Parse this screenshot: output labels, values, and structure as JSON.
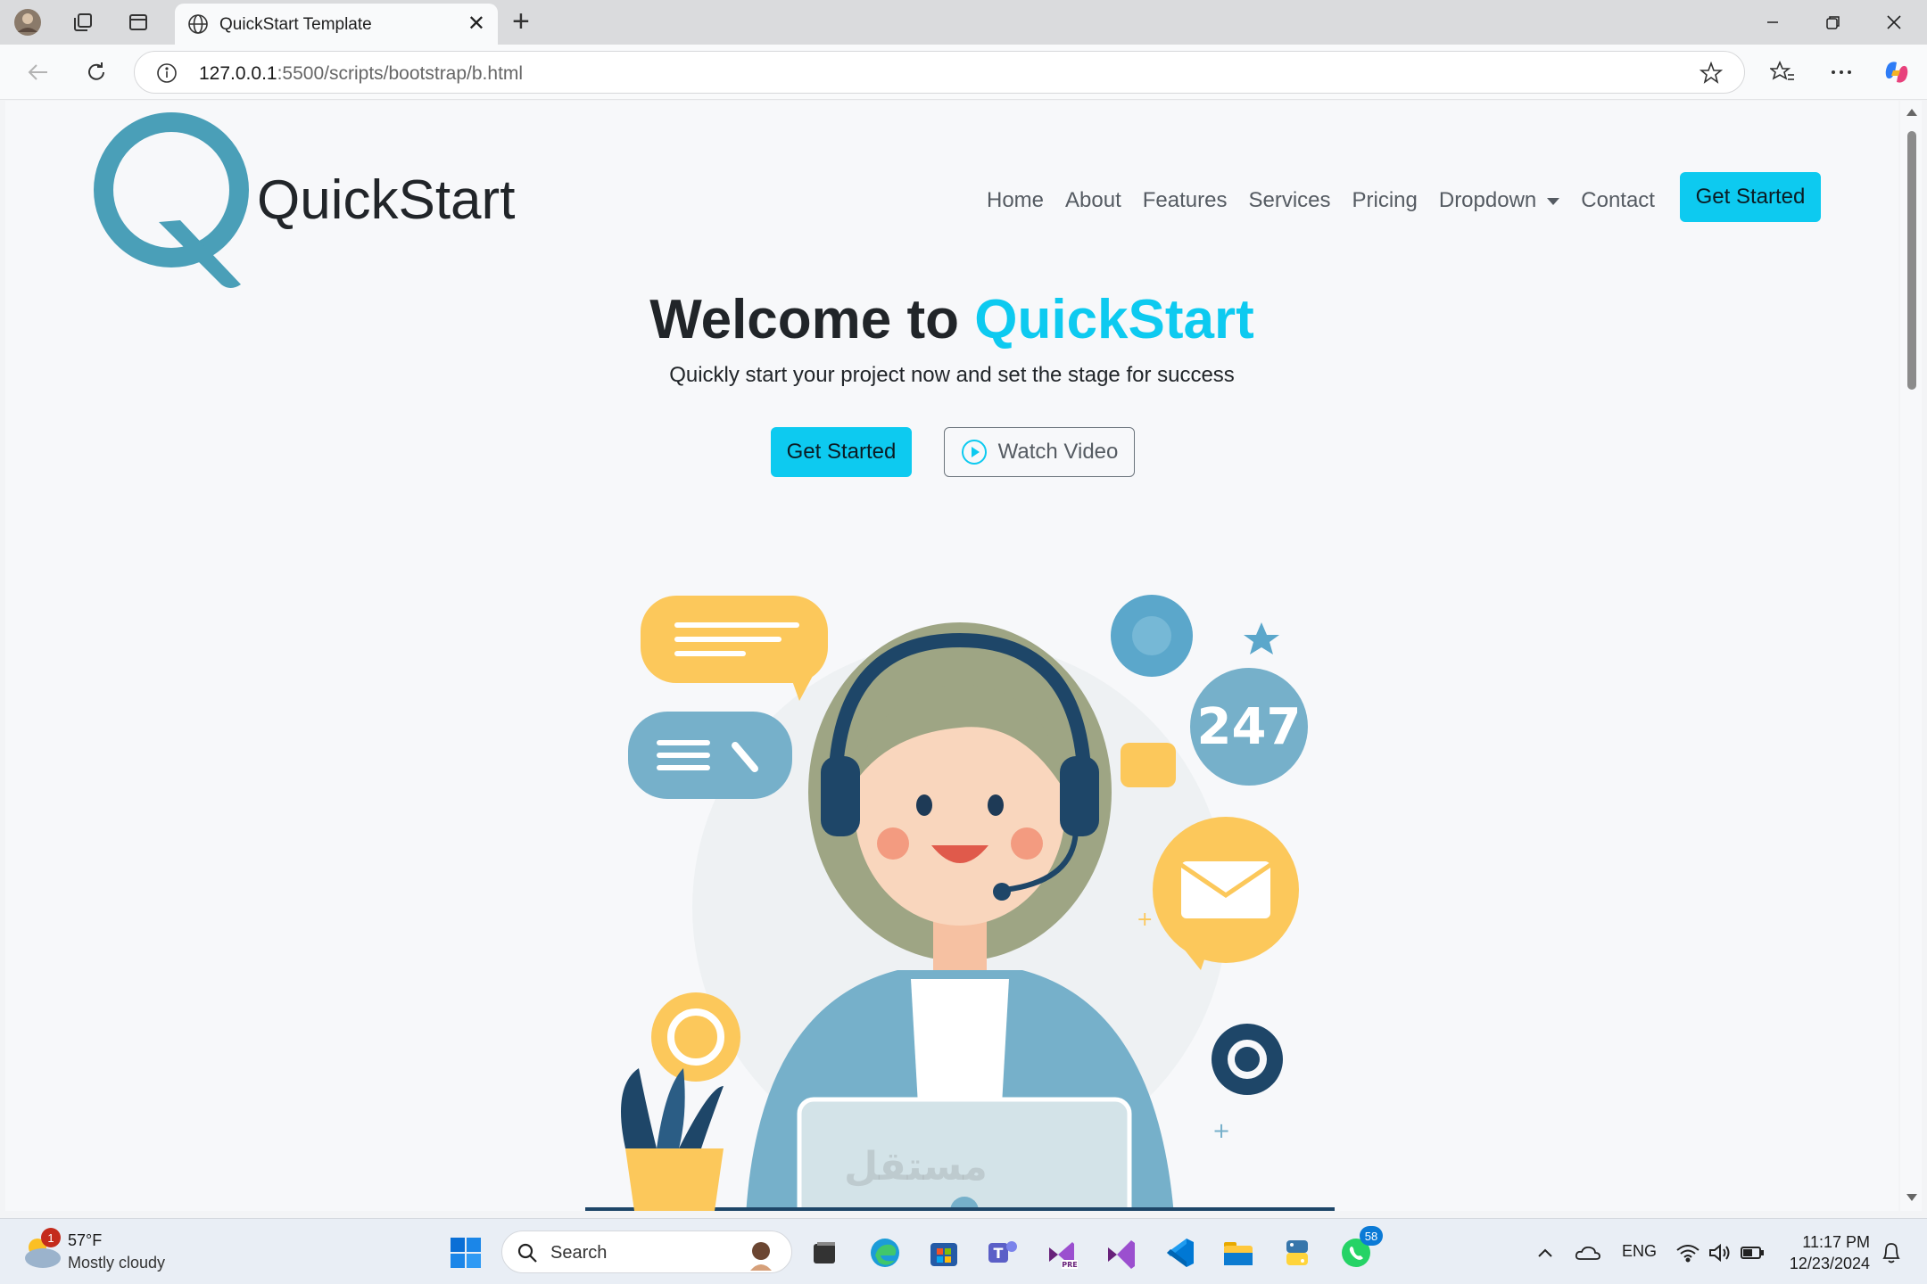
{
  "browser": {
    "tab_title": "QuickStart Template",
    "url_host": "127.0.0.1",
    "url_rest": ":5500/scripts/bootstrap/b.html"
  },
  "site": {
    "brand": "QuickStart",
    "nav": {
      "home": "Home",
      "about": "About",
      "features": "Features",
      "services": "Services",
      "pricing": "Pricing",
      "dropdown": "Dropdown",
      "contact": "Contact",
      "cta": "Get Started"
    },
    "hero": {
      "title_prefix": "Welcome to ",
      "title_accent": "QuickStart",
      "subtitle": "Quickly start your project now and set the stage for success",
      "primary_button": "Get Started",
      "secondary_button": "Watch Video"
    },
    "illustration": {
      "badge_text": "247"
    },
    "watermark": "مستقل"
  },
  "taskbar": {
    "weather_temp": "57°F",
    "weather_desc": "Mostly cloudy",
    "weather_badge": "1",
    "search_label": "Search",
    "whatsapp_badge": "58",
    "lang": "ENG",
    "time": "11:17 PM",
    "date": "12/23/2024"
  },
  "colors": {
    "accent": "#0dcaf0",
    "logo": "#4a9fb8",
    "text": "#212529"
  }
}
